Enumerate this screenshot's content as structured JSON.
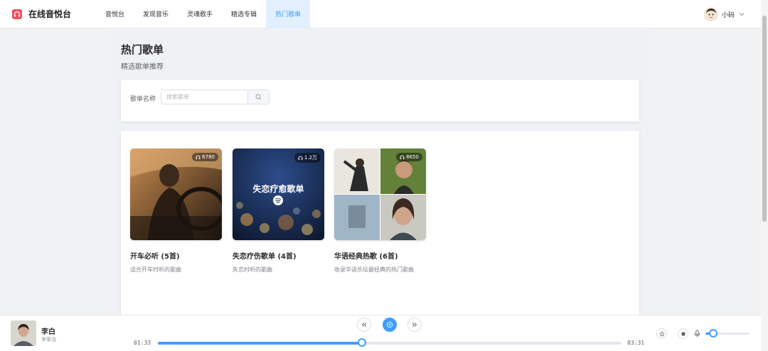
{
  "header": {
    "app_name": "在线音悦台",
    "nav": [
      {
        "label": "音悦台",
        "active": false
      },
      {
        "label": "发现音乐",
        "active": false
      },
      {
        "label": "灵魂歌手",
        "active": false
      },
      {
        "label": "精选专辑",
        "active": false
      },
      {
        "label": "热门歌单",
        "active": true
      }
    ],
    "user_name": "小码"
  },
  "page": {
    "title": "热门歌单",
    "subtitle": "精选歌单推荐"
  },
  "search": {
    "label": "歌单名称",
    "placeholder": "搜索歌单",
    "value": ""
  },
  "playlists": [
    {
      "name": "开车必听 (5首)",
      "desc": "适合开车时听的歌曲",
      "play_count": "6780"
    },
    {
      "name": "失恋疗伤歌单 (4首)",
      "desc": "失恋时听的歌曲",
      "play_count": "1.2万",
      "cover_text": "失恋疗愈歌单"
    },
    {
      "name": "华语经典热歌 (6首)",
      "desc": "收录华语乐坛最经典的热门歌曲",
      "play_count": "8650"
    }
  ],
  "player": {
    "title": "李白",
    "artist": "李荣浩",
    "current_time": "01:33",
    "total_time": "03:31",
    "progress": 0.44,
    "volume": 0.18
  },
  "colors": {
    "accent": "#409eff",
    "brand": "#ef4f5b"
  }
}
